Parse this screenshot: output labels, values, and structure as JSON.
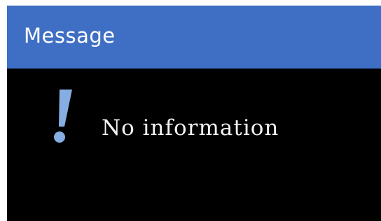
{
  "dialog": {
    "title": "Message",
    "message": "No information",
    "icon": "exclamation-icon"
  },
  "colors": {
    "title_bar": "#3f6fc4",
    "background": "#000000",
    "icon": "#86aee2",
    "text": "#f2f2f2"
  }
}
